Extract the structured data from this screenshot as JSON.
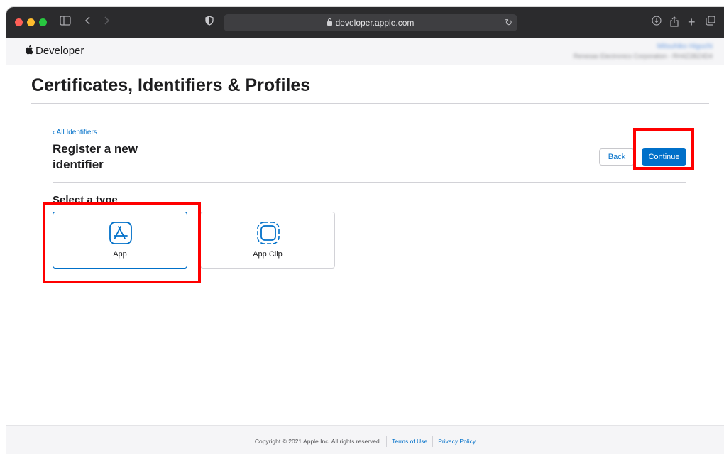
{
  "browser": {
    "url": "developer.apple.com",
    "icons": [
      "sidebar-icon",
      "back-icon",
      "forward-icon",
      "privacy-shield-icon",
      "lock-icon",
      "reload-icon",
      "download-icon",
      "share-icon",
      "new-tab-icon",
      "tabs-overview-icon"
    ]
  },
  "globalnav": {
    "brand": "Developer",
    "account_name": "Mitsuhiko Higuchi",
    "account_org": "Renesas Electronics Corporation - RH4Z2BZ4D4"
  },
  "page": {
    "title": "Certificates, Identifiers & Profiles",
    "breadcrumb": "‹ All Identifiers",
    "section_title": "Register a new identifier",
    "back_label": "Back",
    "continue_label": "Continue",
    "select_type_label": "Select a type",
    "types": [
      {
        "label": "App",
        "icon": "app-store-icon",
        "selected": true
      },
      {
        "label": "App Clip",
        "icon": "app-clip-icon",
        "selected": false
      }
    ]
  },
  "footer": {
    "copyright": "Copyright © 2021 Apple Inc. All rights reserved.",
    "terms": "Terms of Use",
    "privacy": "Privacy Policy"
  },
  "colors": {
    "accent": "#0070c9",
    "annotation": "#ff0000",
    "toolbar": "#2b2b2d"
  }
}
